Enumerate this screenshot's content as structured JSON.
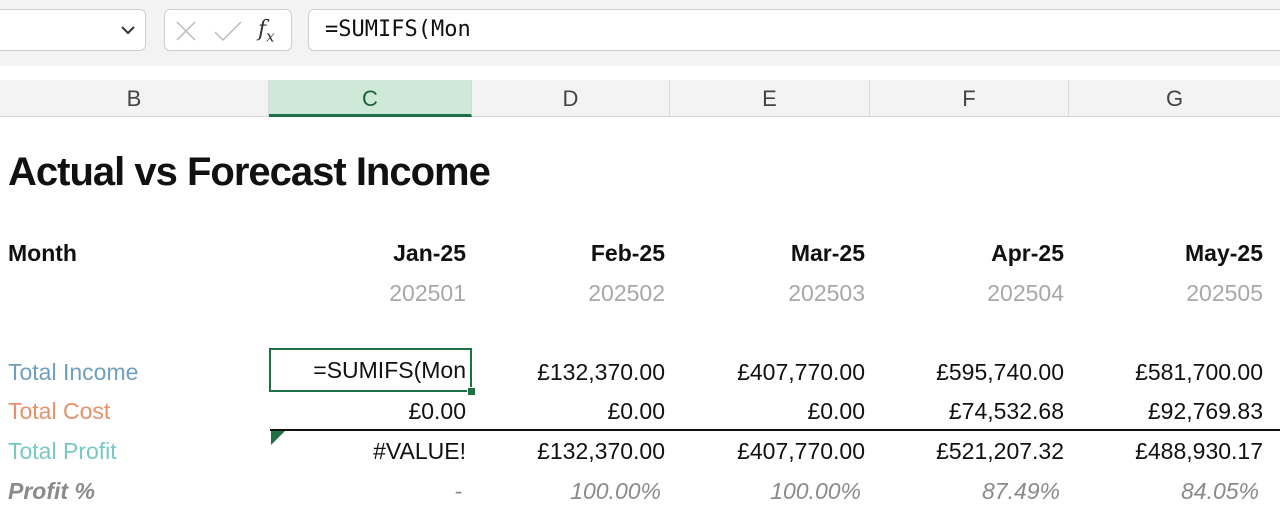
{
  "formula_bar": {
    "name_box": "",
    "fx_label": "f",
    "fx_sub": "x",
    "formula": "=SUMIFS(Mon"
  },
  "columns": [
    "B",
    "C",
    "D",
    "E",
    "F",
    "G"
  ],
  "selected_column": "C",
  "sheet": {
    "title": "Actual vs Forecast Income",
    "month_label": "Month",
    "months": [
      "Jan-25",
      "Feb-25",
      "Mar-25",
      "Apr-25",
      "May-25"
    ],
    "codes": [
      "202501",
      "202502",
      "202503",
      "202504",
      "202505"
    ],
    "rows": {
      "income": {
        "label": "Total Income",
        "values": [
          "=SUMIFS(Mon",
          "£132,370.00",
          "£407,770.00",
          "£595,740.00",
          "£581,700.00"
        ]
      },
      "cost": {
        "label": "Total Cost",
        "values": [
          "£0.00",
          "£0.00",
          "£0.00",
          "£74,532.68",
          "£92,769.83"
        ]
      },
      "profit": {
        "label": "Total Profit",
        "values": [
          "#VALUE!",
          "£132,370.00",
          "£407,770.00",
          "£521,207.32",
          "£488,930.17"
        ]
      },
      "pct": {
        "label": "Profit %",
        "values": [
          "-",
          "100.00%",
          "100.00%",
          "87.49%",
          "84.05%"
        ]
      }
    },
    "colors": {
      "income": "#6f9fbf",
      "cost": "#e8906a",
      "profit": "#78c9c3",
      "accent": "#1e7145"
    }
  }
}
